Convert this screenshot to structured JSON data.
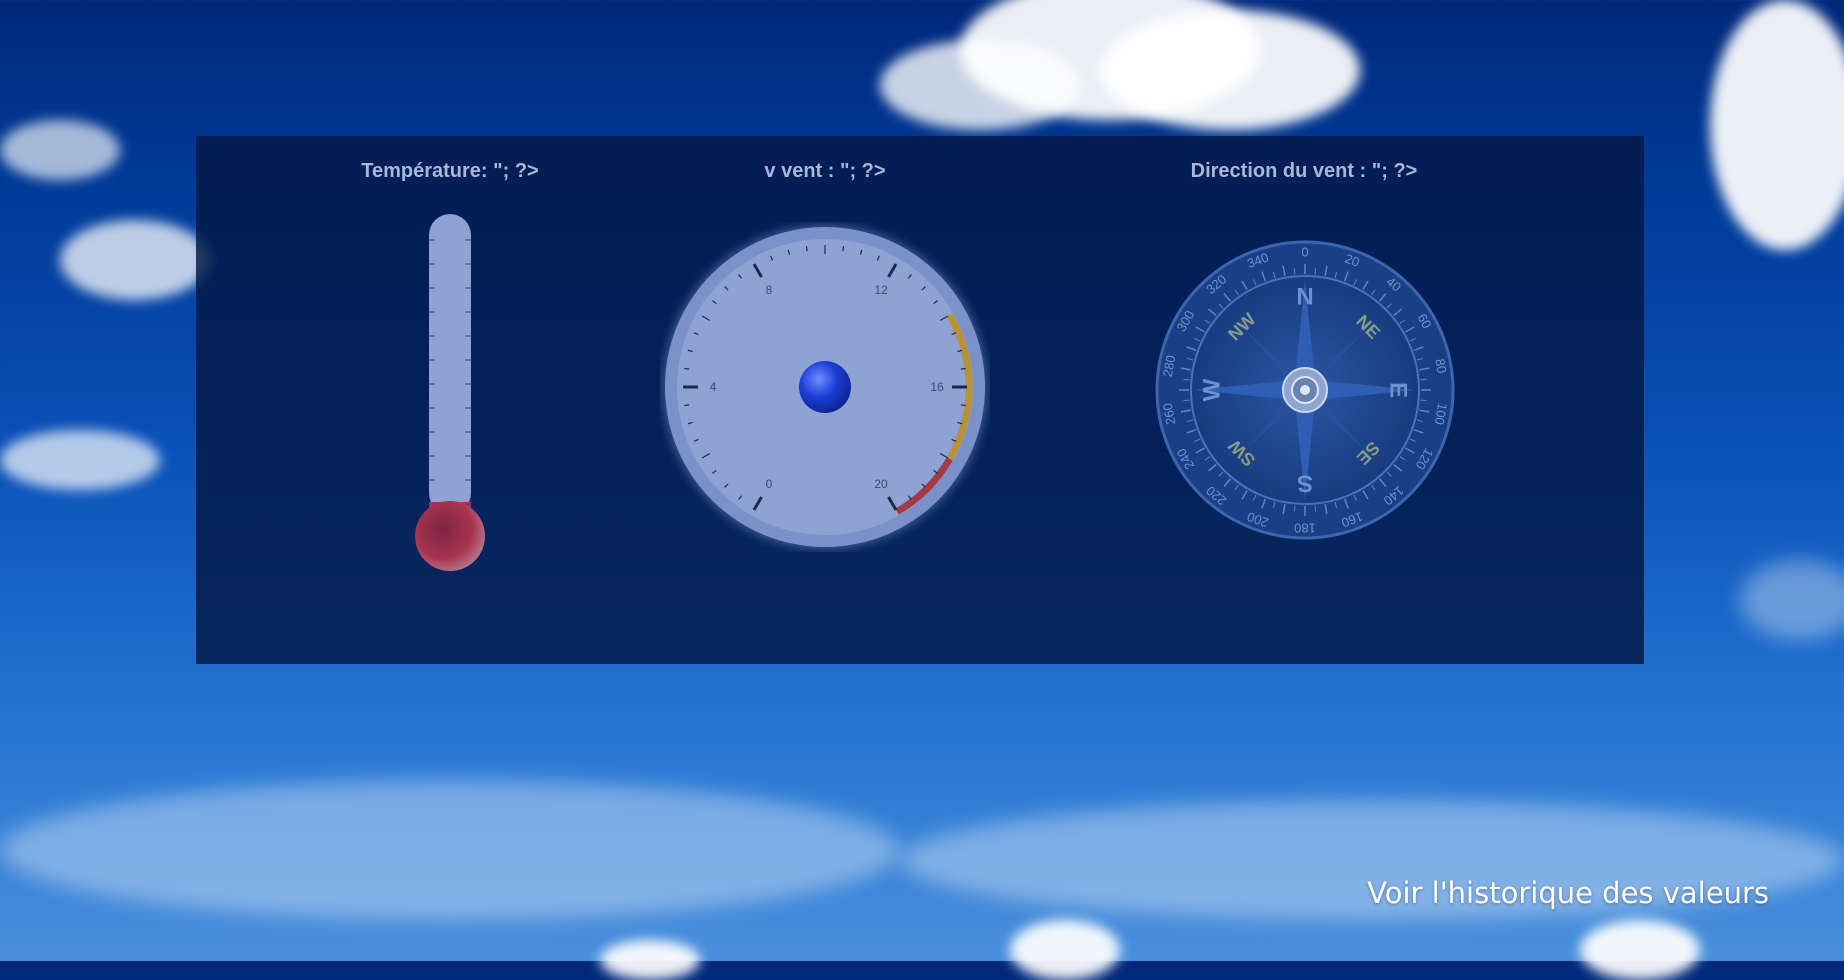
{
  "labels": {
    "temperature": "Température: \"; ?>",
    "wind_speed": "v vent : \"; ?>",
    "wind_direction": "Direction du vent : \"; ?>"
  },
  "speed_gauge": {
    "tick_labels": [
      "0",
      "4",
      "8",
      "12",
      "16",
      "20"
    ]
  },
  "compass": {
    "cardinals": [
      "N",
      "NE",
      "E",
      "SE",
      "S",
      "SW",
      "W",
      "NW"
    ],
    "degree_labels": [
      "0",
      "20",
      "40",
      "60",
      "80",
      "100",
      "120",
      "140",
      "160",
      "180",
      "200",
      "220",
      "240",
      "260",
      "280",
      "300",
      "320",
      "340"
    ]
  },
  "link": {
    "history": "Voir l'historique des valeurs"
  },
  "colors": {
    "gauge_face": "#8ea3d3",
    "needle_hub": "#1b3fd6",
    "warning_band": "#b8913a",
    "danger_band": "#a33a47",
    "thermo_bulb": "#a8344e"
  }
}
